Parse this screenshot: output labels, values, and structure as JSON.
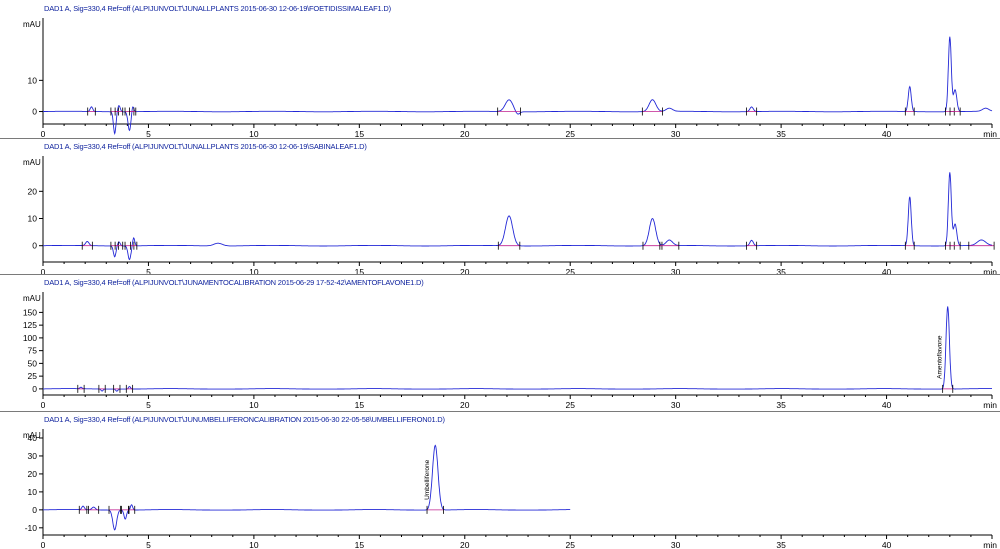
{
  "chart_data": [
    {
      "type": "line",
      "title": "DAD1 A, Sig=330,4 Ref=off (ALPIJUNVOLT\\JUNALLPLANTS 2015-06-30 12-06-19\\FOETIDISSIMALEAF1.D)",
      "ylabel": "mAU",
      "xlabel": "min",
      "xlim": [
        0,
        45
      ],
      "ylim": [
        -4,
        30
      ],
      "xticks": [
        0,
        5,
        10,
        15,
        20,
        25,
        30,
        35,
        40
      ],
      "yticks": [
        0,
        10
      ],
      "baseline": 0,
      "peaks": [
        {
          "x": 2.3,
          "h": 1.5,
          "w": 0.06
        },
        {
          "x": 3.4,
          "h": -7,
          "w": 0.06
        },
        {
          "x": 3.6,
          "h": 2,
          "w": 0.06
        },
        {
          "x": 4.1,
          "h": -6,
          "w": 0.07
        },
        {
          "x": 4.25,
          "h": 2,
          "w": 0.05
        },
        {
          "x": 22.1,
          "h": 3.8,
          "w": 0.18
        },
        {
          "x": 22.5,
          "h": -1,
          "w": 0.1
        },
        {
          "x": 28.9,
          "h": 3.8,
          "w": 0.16
        },
        {
          "x": 29.7,
          "h": 1,
          "w": 0.15
        },
        {
          "x": 33.6,
          "h": 1.5,
          "w": 0.08
        },
        {
          "x": 41.1,
          "h": 8,
          "w": 0.07
        },
        {
          "x": 43.0,
          "h": 24,
          "w": 0.07
        },
        {
          "x": 43.25,
          "h": 7,
          "w": 0.08
        },
        {
          "x": 44.7,
          "h": 1,
          "w": 0.15
        }
      ]
    },
    {
      "type": "line",
      "title": "DAD1 A, Sig=330,4 Ref=off (ALPIJUNVOLT\\JUNALLPLANTS 2015-06-30 12-06-19\\SABINALEAF1.D)",
      "ylabel": "mAU",
      "xlabel": "min",
      "xlim": [
        0,
        45
      ],
      "ylim": [
        -6,
        33
      ],
      "xticks": [
        0,
        5,
        10,
        15,
        20,
        25,
        30,
        35,
        40
      ],
      "yticks": [
        0,
        10,
        20
      ],
      "baseline": 0,
      "peaks": [
        {
          "x": 2.1,
          "h": 1.5,
          "w": 0.08
        },
        {
          "x": 3.4,
          "h": -4,
          "w": 0.06
        },
        {
          "x": 3.6,
          "h": 1.5,
          "w": 0.06
        },
        {
          "x": 4.1,
          "h": -5,
          "w": 0.07
        },
        {
          "x": 4.3,
          "h": 3,
          "w": 0.05
        },
        {
          "x": 8.3,
          "h": 1,
          "w": 0.2
        },
        {
          "x": 22.1,
          "h": 11,
          "w": 0.17
        },
        {
          "x": 28.9,
          "h": 10,
          "w": 0.15
        },
        {
          "x": 29.7,
          "h": 2,
          "w": 0.15
        },
        {
          "x": 33.6,
          "h": 2,
          "w": 0.08
        },
        {
          "x": 41.1,
          "h": 18,
          "w": 0.07
        },
        {
          "x": 43.0,
          "h": 27,
          "w": 0.07
        },
        {
          "x": 43.25,
          "h": 8,
          "w": 0.08
        },
        {
          "x": 44.5,
          "h": 2,
          "w": 0.2
        }
      ]
    },
    {
      "type": "line",
      "title": "DAD1 A, Sig=330,4 Ref=off (ALPIJUNVOLT\\JUNAMENTOCALIBRATION 2015-06-29 17-52-42\\AMENTOFLAVONE1.D)",
      "ylabel": "mAU",
      "xlabel": "min",
      "xlim": [
        0,
        45
      ],
      "ylim": [
        -12,
        190
      ],
      "xticks": [
        0,
        5,
        10,
        15,
        20,
        25,
        30,
        35,
        40
      ],
      "yticks": [
        0,
        25,
        50,
        75,
        100,
        125,
        150
      ],
      "baseline": 0,
      "peaks": [
        {
          "x": 1.8,
          "h": 3,
          "w": 0.05
        },
        {
          "x": 2.8,
          "h": -4,
          "w": 0.05
        },
        {
          "x": 3.5,
          "h": -4,
          "w": 0.05
        },
        {
          "x": 4.1,
          "h": 5,
          "w": 0.05
        },
        {
          "x": 42.9,
          "h": 162,
          "w": 0.08
        }
      ],
      "peak_labels": [
        {
          "x": 42.9,
          "text": "Amentoflavone"
        }
      ]
    },
    {
      "type": "line",
      "title": "DAD1 A, Sig=330,4 Ref=off (ALPIJUNVOLT\\JUNUMBELLIFERONCALIBRATION 2015-06-30 22-05-58\\UMBELLIFERON01.D)",
      "ylabel": "mAU",
      "xlabel": "min",
      "xlim": [
        0,
        45
      ],
      "ylim": [
        -14,
        45
      ],
      "xticks": [
        0,
        5,
        10,
        15,
        20,
        25,
        30,
        35,
        40
      ],
      "yticks": [
        -10,
        0,
        10,
        20,
        30,
        40
      ],
      "baseline": 0,
      "x_end": 25,
      "peaks": [
        {
          "x": 1.9,
          "h": 2,
          "w": 0.06
        },
        {
          "x": 2.4,
          "h": 1.5,
          "w": 0.08
        },
        {
          "x": 3.4,
          "h": -11,
          "w": 0.09
        },
        {
          "x": 3.9,
          "h": -5,
          "w": 0.06
        },
        {
          "x": 4.2,
          "h": 3,
          "w": 0.05
        },
        {
          "x": 18.6,
          "h": 36,
          "w": 0.13
        }
      ],
      "peak_labels": [
        {
          "x": 18.6,
          "text": "Umbelliferone"
        }
      ]
    }
  ],
  "colors": {
    "trace": "#2328d6",
    "integration": "#c0208f",
    "axis": "#000000",
    "title": "#0b1f9c"
  }
}
